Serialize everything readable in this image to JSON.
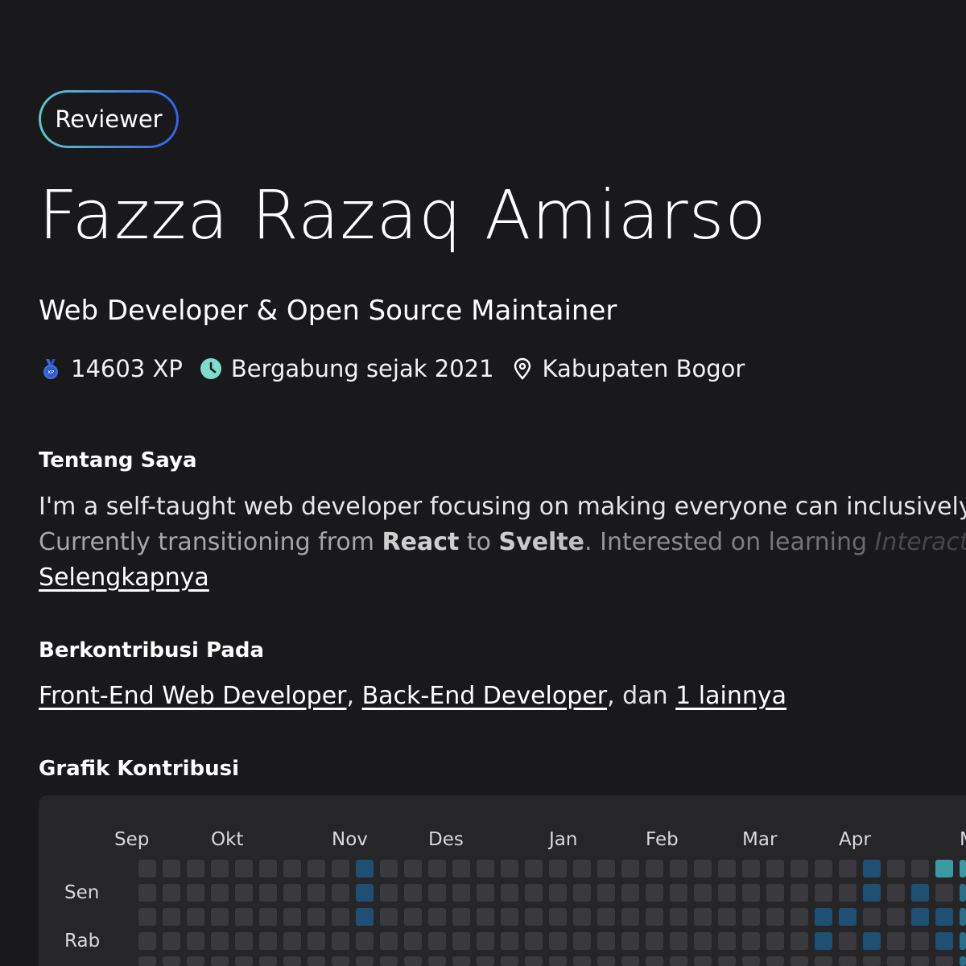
{
  "profile": {
    "badge": "Reviewer",
    "name": "Fazza Razaq Amiarso",
    "title": "Web Developer & Open Source Maintainer",
    "xp": "14603 XP",
    "joined": "Bergabung sejak 2021",
    "location": "Kabupaten Bogor"
  },
  "about": {
    "heading": "Tentang Saya",
    "line1": "I'm a self-taught web developer focusing on making everyone can inclusively u",
    "line2_a": "Currently transitioning from ",
    "line2_b": "React",
    "line2_c": " to ",
    "line2_d": "Svelte",
    "line2_e": ". Interested on learning ",
    "line2_f": "Interactive",
    "more_link": "Selengkapnya"
  },
  "contributions": {
    "heading": "Berkontribusi Pada",
    "items": [
      "Front-End Web Developer",
      "Back-End Developer"
    ],
    "separator": ", ",
    "conjunction": ", dan ",
    "others_link": "1 lainnya"
  },
  "graph": {
    "heading": "Grafik Kontribusi",
    "months": [
      "Sep",
      "Okt",
      "Nov",
      "Des",
      "Jan",
      "Feb",
      "Mar",
      "Apr",
      "M"
    ],
    "day_labels": [
      "Sen",
      "Rab"
    ],
    "level_colors": [
      "#3a3a3e",
      "#1f4f73",
      "#2a6f8a",
      "#3a9aa3",
      "#5cc6c8"
    ]
  },
  "icons": {
    "xp": "medal-icon",
    "joined": "clock-icon",
    "location": "map-pin-icon"
  },
  "colors": {
    "background": "#19191b",
    "badge_gradient_start": "#5cc6c8",
    "badge_gradient_end": "#3561e6",
    "graph_panel": "#262628"
  }
}
